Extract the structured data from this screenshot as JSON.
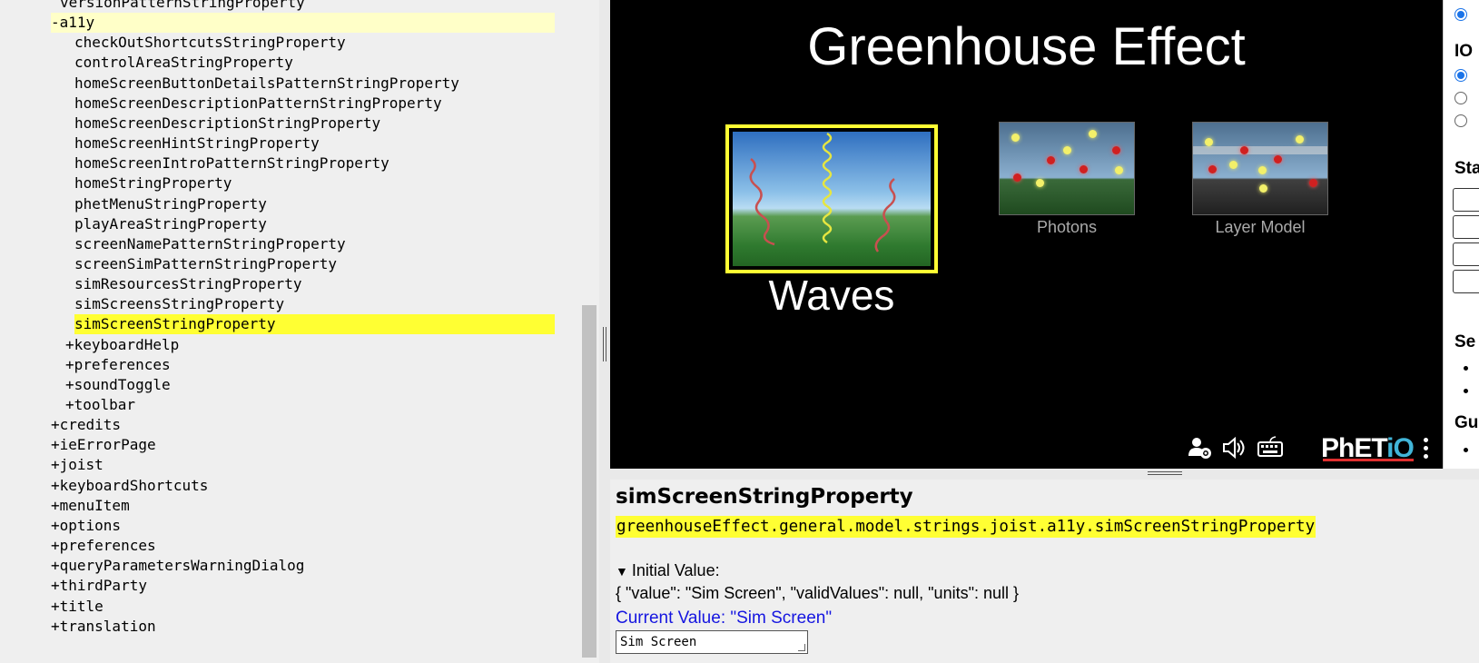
{
  "tree": {
    "rows": [
      {
        "label": "versionPatternStringProperty",
        "indent": 1,
        "state": "none"
      },
      {
        "label": "-a11y",
        "indent": 0,
        "state": "parent"
      },
      {
        "label": "checkOutShortcutsStringProperty",
        "indent": 2,
        "state": "none"
      },
      {
        "label": "controlAreaStringProperty",
        "indent": 2,
        "state": "none"
      },
      {
        "label": "homeScreenButtonDetailsPatternStringProperty",
        "indent": 2,
        "state": "none"
      },
      {
        "label": "homeScreenDescriptionPatternStringProperty",
        "indent": 2,
        "state": "none"
      },
      {
        "label": "homeScreenDescriptionStringProperty",
        "indent": 2,
        "state": "none"
      },
      {
        "label": "homeScreenHintStringProperty",
        "indent": 2,
        "state": "none"
      },
      {
        "label": "homeScreenIntroPatternStringProperty",
        "indent": 2,
        "state": "none"
      },
      {
        "label": "homeStringProperty",
        "indent": 2,
        "state": "none"
      },
      {
        "label": "phetMenuStringProperty",
        "indent": 2,
        "state": "none"
      },
      {
        "label": "playAreaStringProperty",
        "indent": 2,
        "state": "none"
      },
      {
        "label": "screenNamePatternStringProperty",
        "indent": 2,
        "state": "none"
      },
      {
        "label": "screenSimPatternStringProperty",
        "indent": 2,
        "state": "none"
      },
      {
        "label": "simResourcesStringProperty",
        "indent": 2,
        "state": "none"
      },
      {
        "label": "simScreensStringProperty",
        "indent": 2,
        "state": "none"
      },
      {
        "label": "simScreenStringProperty",
        "indent": 2,
        "state": "selected"
      },
      {
        "label": "+keyboardHelp",
        "indent": 3,
        "state": "none"
      },
      {
        "label": "+preferences",
        "indent": 3,
        "state": "none"
      },
      {
        "label": "+soundToggle",
        "indent": 3,
        "state": "none"
      },
      {
        "label": "+toolbar",
        "indent": 3,
        "state": "none"
      },
      {
        "label": "+credits",
        "indent": 0,
        "state": "none"
      },
      {
        "label": "+ieErrorPage",
        "indent": 0,
        "state": "none"
      },
      {
        "label": "+joist",
        "indent": 0,
        "state": "none"
      },
      {
        "label": "+keyboardShortcuts",
        "indent": 0,
        "state": "none"
      },
      {
        "label": "+menuItem",
        "indent": 0,
        "state": "none"
      },
      {
        "label": "+options",
        "indent": 0,
        "state": "none"
      },
      {
        "label": "+preferences",
        "indent": 0,
        "state": "none"
      },
      {
        "label": "+queryParametersWarningDialog",
        "indent": 0,
        "state": "none"
      },
      {
        "label": "+thirdParty",
        "indent": 0,
        "state": "none"
      },
      {
        "label": "+title",
        "indent": 0,
        "state": "none"
      },
      {
        "label": "+translation",
        "indent": 0,
        "state": "none"
      }
    ]
  },
  "sim": {
    "title": "Greenhouse Effect",
    "screens": [
      {
        "label": "Waves",
        "selected": true
      },
      {
        "label": "Photons",
        "selected": false
      },
      {
        "label": "Layer Model",
        "selected": false
      }
    ],
    "navbar": {
      "icons": [
        "preferences-user-gear-icon",
        "sound-speaker-icon",
        "keyboard-icon",
        "kebab-menu-icon"
      ],
      "logo_text": "PhET",
      "logo_suffix": "iO"
    }
  },
  "right_panel": {
    "headings": [
      "IO",
      "Sta",
      "Se",
      "Gu"
    ]
  },
  "details": {
    "name": "simScreenStringProperty",
    "phetio_id": "greenhouseEffect.general.model.strings.joist.a11y.simScreenStringProperty",
    "initial_value_label": "Initial Value:",
    "initial_value_json": "{ \"value\": \"Sim Screen\", \"validValues\": null, \"units\": null }",
    "current_value_label": "Current Value: \"Sim Screen\"",
    "input_value": "Sim Screen"
  },
  "colors": {
    "selection": "#ffff33",
    "selection_parent": "#ffffc8",
    "link_blue": "#1515e0",
    "sim_background": "#000000",
    "waves_border": "#ffff33"
  }
}
